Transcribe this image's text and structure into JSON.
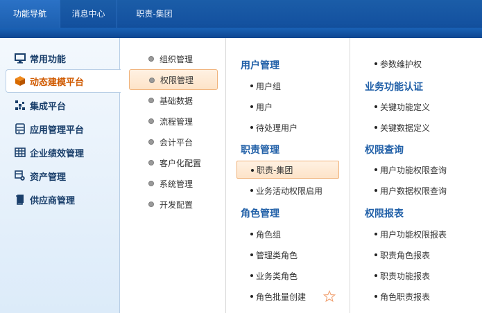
{
  "topnav": {
    "tabs": [
      {
        "label": "功能导航"
      },
      {
        "label": "消息中心"
      },
      {
        "label": "职责-集团"
      }
    ]
  },
  "sidebar": {
    "items": [
      {
        "label": "常用功能",
        "icon": "monitor-icon"
      },
      {
        "label": "动态建模平台",
        "icon": "cube-icon"
      },
      {
        "label": "集成平台",
        "icon": "grid-dots-icon"
      },
      {
        "label": "应用管理平台",
        "icon": "server-icon"
      },
      {
        "label": "企业绩效管理",
        "icon": "table-icon"
      },
      {
        "label": "资产管理",
        "icon": "asset-icon"
      },
      {
        "label": "供应商管理",
        "icon": "documents-icon"
      }
    ]
  },
  "submenu": {
    "items": [
      {
        "label": "组织管理"
      },
      {
        "label": "权限管理"
      },
      {
        "label": "基础数据"
      },
      {
        "label": "流程管理"
      },
      {
        "label": "会计平台"
      },
      {
        "label": "客户化配置"
      },
      {
        "label": "系统管理"
      },
      {
        "label": "开发配置"
      }
    ]
  },
  "col3": {
    "s1_title": "用户管理",
    "s1_items": [
      "用户组",
      "用户",
      "待处理用户"
    ],
    "s2_title": "职责管理",
    "s2_items": [
      "职责-集团",
      "业务活动权限启用"
    ],
    "s3_title": "角色管理",
    "s3_items": [
      "角色组",
      "管理类角色",
      "业务类角色",
      "角色批量创建"
    ]
  },
  "col4": {
    "s0_items": [
      "参数维护权"
    ],
    "s1_title": "业务功能认证",
    "s1_items": [
      "关键功能定义",
      "关键数据定义"
    ],
    "s2_title": "权限查询",
    "s2_items": [
      "用户功能权限查询",
      "用户数据权限查询"
    ],
    "s3_title": "权限报表",
    "s3_items": [
      "用户功能权限报表",
      "职责角色报表",
      "职责功能报表",
      "角色职责报表"
    ]
  },
  "colors": {
    "accent": "#d05a00",
    "section_title": "#2160a8",
    "nav_blue": "#1452a0"
  }
}
